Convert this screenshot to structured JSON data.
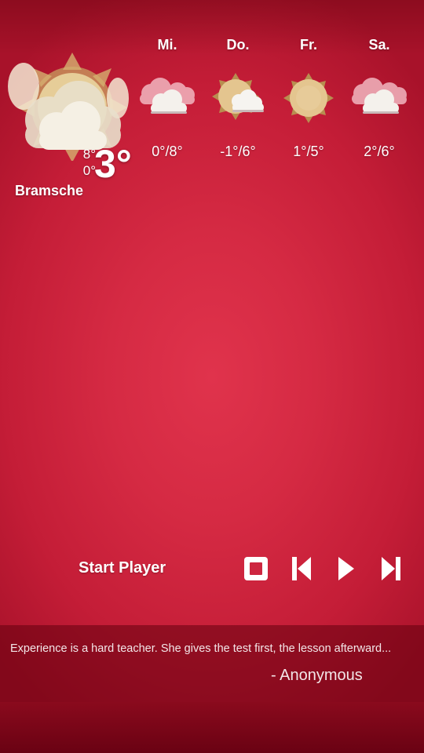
{
  "weather": {
    "city": "Bramsche",
    "current": {
      "temp": "3°",
      "high": "8°",
      "low": "0°",
      "icon": "partly-cloudy-sun-icon"
    },
    "forecast": [
      {
        "day": "Mi.",
        "temps": "0°/8°",
        "icon": "cloudy-icon"
      },
      {
        "day": "Do.",
        "temps": "-1°/6°",
        "icon": "sun-with-clouds-icon"
      },
      {
        "day": "Fr.",
        "temps": "1°/5°",
        "icon": "sun-icon"
      },
      {
        "day": "Sa.",
        "temps": "2°/6°",
        "icon": "cloudy-icon"
      }
    ]
  },
  "player": {
    "start_label": "Start Player",
    "controls": [
      "stop-icon",
      "previous-icon",
      "play-icon",
      "next-icon"
    ]
  },
  "quote": {
    "text": "Experience is a hard teacher. She gives the test first, the lesson afterward...",
    "author": "- Anonymous"
  },
  "colors": {
    "background": "#d52a43",
    "icon_beige": "#e6c896",
    "cloud_pink": "#f0b8c0"
  }
}
